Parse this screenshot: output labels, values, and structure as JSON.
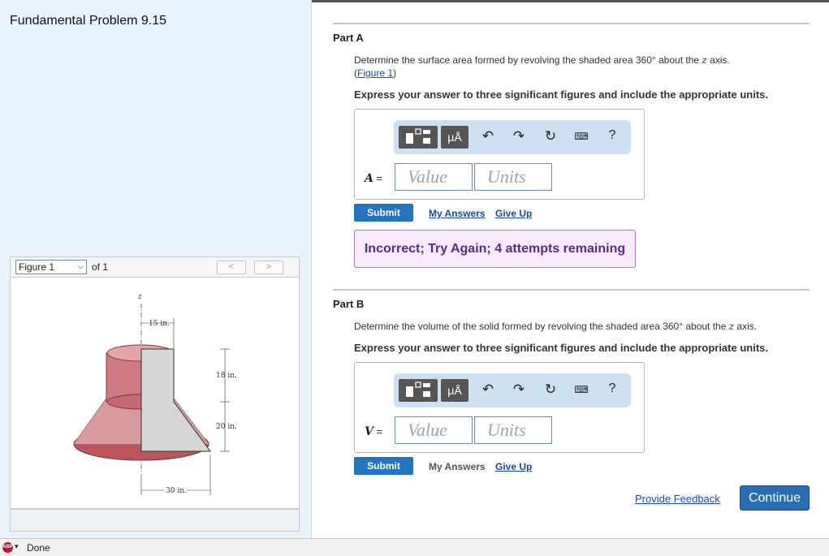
{
  "problem": {
    "title": "Fundamental Problem 9.15"
  },
  "figure_viewer": {
    "selected": "Figure 1",
    "of_label": "of 1",
    "prev_symbol": "<",
    "next_symbol": ">",
    "labels": {
      "z": "z",
      "d15": "15 in.",
      "d18": "18 in.",
      "d20": "20 in.",
      "d30": "30 in."
    }
  },
  "part_a": {
    "heading": "Part A",
    "question": "Determine the surface area formed by revolving the shaded area 360° about the",
    "axis_var": "z",
    "question_end": " axis.",
    "figure_link": "Figure 1",
    "instruction": "Express your answer to three significant figures and include the appropriate units.",
    "var_label": "A",
    "eq": " =",
    "value_placeholder": "Value",
    "units_placeholder": "Units",
    "submit_label": "Submit",
    "my_answers_label": "My Answers",
    "give_up_label": "Give Up",
    "feedback": "Incorrect; Try Again; 4 attempts remaining"
  },
  "part_b": {
    "heading": "Part B",
    "question": "Determine the volume of the solid formed by revolving the shaded area 360° about the",
    "axis_var": "z",
    "question_end": " axis.",
    "instruction": "Express your answer to three significant figures and include the appropriate units.",
    "var_label": "V",
    "eq": " =",
    "value_placeholder": "Value",
    "units_placeholder": "Units",
    "submit_label": "Submit",
    "my_answers_label": "My Answers",
    "give_up_label": "Give Up"
  },
  "toolbar": {
    "mu_label": "μÅ",
    "help": "?",
    "icons": [
      "templates-icon",
      "units-icon",
      "undo-icon",
      "redo-icon",
      "reset-icon",
      "keyboard-icon",
      "help-icon"
    ]
  },
  "footer": {
    "feedback_link": "Provide Feedback",
    "continue_label": "Continue"
  },
  "status_bar": {
    "text": "Done",
    "badge": "ABP"
  },
  "colors": {
    "accent": "#2673bf",
    "feedback_bg": "#f8eafd",
    "feedback_text": "#5a2a86"
  }
}
